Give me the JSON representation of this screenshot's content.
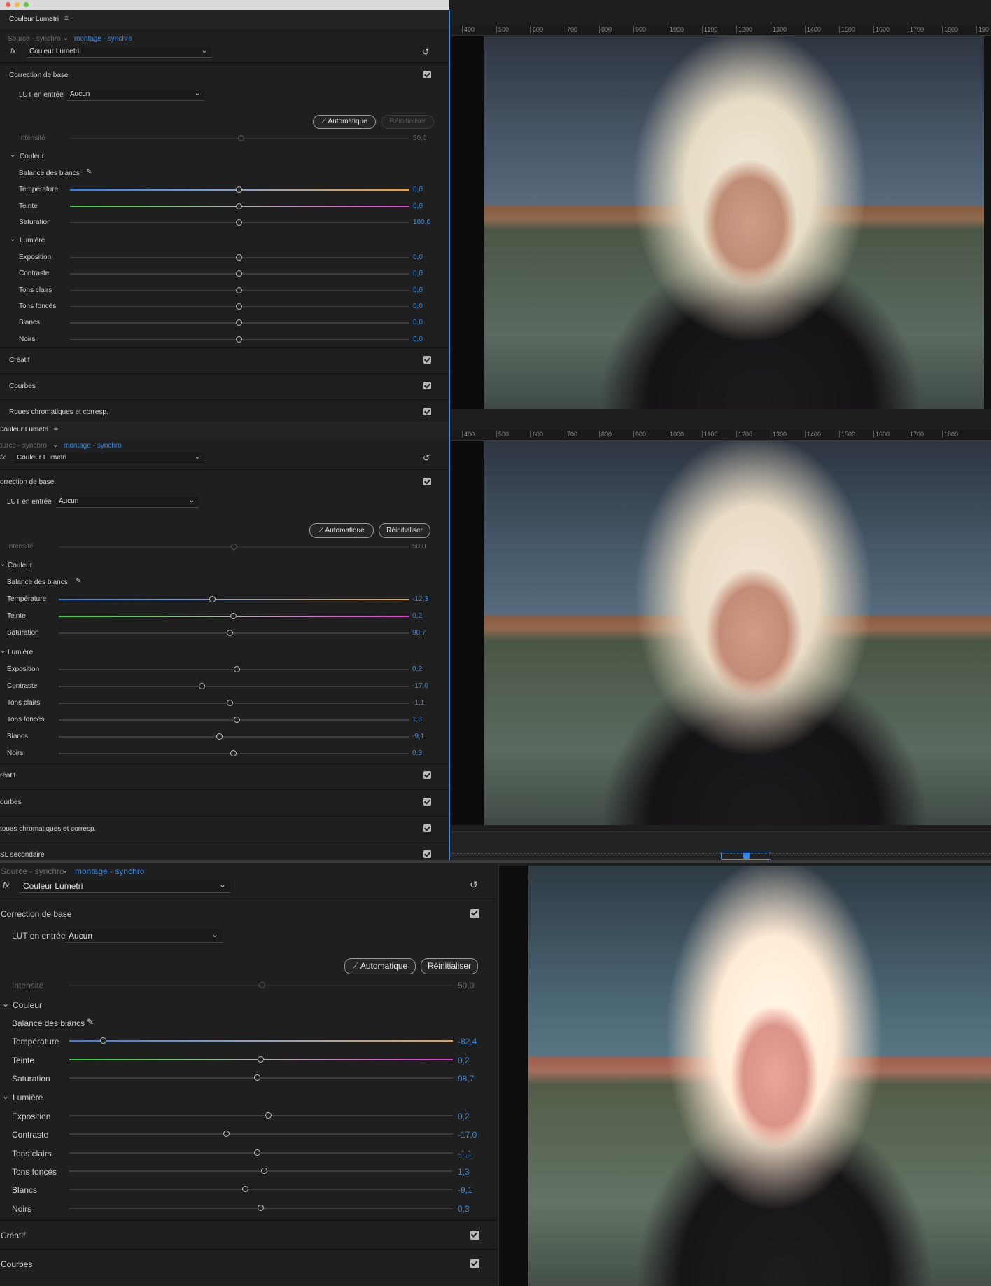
{
  "colors": {
    "accent": "#2d8ceb",
    "panel_bg": "#1f1f1f",
    "temp_left": "#2f7ff0",
    "temp_right": "#f0a030",
    "tint_left": "#39d13a",
    "tint_right": "#e23ed6"
  },
  "shots": [
    {
      "panel_title": "Couleur Lumetri",
      "source": "Source - synchro",
      "sequence": "montage - synchro",
      "effect": "Couleur Lumetri",
      "section_basic": "Correction de base",
      "lut_label": "LUT en entrée",
      "lut_value": "Aucun",
      "auto_button": "Automatique",
      "reset_button": "Réinitialiser",
      "reset_enabled": false,
      "intensity": {
        "label": "Intensité",
        "value": "50,0",
        "pos": 0.5
      },
      "color_header": "Couleur",
      "wb_label": "Balance des blancs",
      "color_sliders": [
        {
          "label": "Température",
          "value": "0,0",
          "pos": 0.5,
          "kind": "temp"
        },
        {
          "label": "Teinte",
          "value": "0,0",
          "pos": 0.5,
          "kind": "tint"
        },
        {
          "label": "Saturation",
          "value": "100,0",
          "pos": 0.5,
          "kind": "plain"
        }
      ],
      "light_header": "Lumière",
      "light_sliders": [
        {
          "label": "Exposition",
          "value": "0,0",
          "pos": 0.5
        },
        {
          "label": "Contraste",
          "value": "0,0",
          "pos": 0.5
        },
        {
          "label": "Tons clairs",
          "value": "0,0",
          "pos": 0.5
        },
        {
          "label": "Tons foncés",
          "value": "0,0",
          "pos": 0.5
        },
        {
          "label": "Blancs",
          "value": "0,0",
          "pos": 0.5
        },
        {
          "label": "Noirs",
          "value": "0,0",
          "pos": 0.5
        }
      ],
      "sections": [
        "Créatif",
        "Courbes",
        "Roues chromatiques et corresp."
      ],
      "ruler": [
        "400",
        "500",
        "600",
        "700",
        "800",
        "900",
        "1000",
        "1100",
        "1200",
        "1300",
        "1400",
        "1500",
        "1600",
        "1700",
        "1800",
        "190"
      ]
    },
    {
      "panel_title": "Couleur Lumetri",
      "source": "ource - synchro",
      "sequence": "montage - synchro",
      "effect": "Couleur Lumetri",
      "section_basic": "orrection de base",
      "lut_label": "LUT en entrée",
      "lut_value": "Aucun",
      "auto_button": "Automatique",
      "reset_button": "Réinitialiser",
      "reset_enabled": true,
      "intensity": {
        "label": "Intensité",
        "value": "50,0",
        "pos": 0.5
      },
      "color_header": "Couleur",
      "wb_label": "Balance des blancs",
      "color_sliders": [
        {
          "label": "Température",
          "value": "-12,3",
          "pos": 0.44,
          "kind": "temp"
        },
        {
          "label": "Teinte",
          "value": "0,2",
          "pos": 0.5,
          "kind": "tint"
        },
        {
          "label": "Saturation",
          "value": "98,7",
          "pos": 0.49,
          "kind": "plain"
        }
      ],
      "light_header": "Lumière",
      "light_sliders": [
        {
          "label": "Exposition",
          "value": "0,2",
          "pos": 0.51
        },
        {
          "label": "Contraste",
          "value": "-17,0",
          "pos": 0.41
        },
        {
          "label": "Tons clairs",
          "value": "-1,1",
          "pos": 0.49
        },
        {
          "label": "Tons foncés",
          "value": "1,3",
          "pos": 0.51
        },
        {
          "label": "Blancs",
          "value": "-9,1",
          "pos": 0.46
        },
        {
          "label": "Noirs",
          "value": "0,3",
          "pos": 0.5
        }
      ],
      "sections": [
        "réatif",
        "ourbes",
        "toues chromatiques et corresp.",
        "SL secondaire"
      ],
      "ruler": [
        "400",
        "500",
        "600",
        "700",
        "800",
        "900",
        "1000",
        "1100",
        "1200",
        "1300",
        "1400",
        "1500",
        "1600",
        "1700",
        "1800"
      ]
    },
    {
      "source": "Source - synchro",
      "sequence": "montage - synchro",
      "effect": "Couleur Lumetri",
      "section_basic": "Correction de base",
      "lut_label": "LUT en entrée",
      "lut_value": "Aucun",
      "auto_button": "Automatique",
      "reset_button": "Réinitialiser",
      "reset_enabled": true,
      "intensity": {
        "label": "Intensité",
        "value": "50,0",
        "pos": 0.5
      },
      "color_header": "Couleur",
      "wb_label": "Balance des blancs",
      "color_sliders": [
        {
          "label": "Température",
          "value": "-82,4",
          "pos": 0.09,
          "kind": "temp"
        },
        {
          "label": "Teinte",
          "value": "0,2",
          "pos": 0.5,
          "kind": "tint"
        },
        {
          "label": "Saturation",
          "value": "98,7",
          "pos": 0.49,
          "kind": "plain"
        }
      ],
      "light_header": "Lumière",
      "light_sliders": [
        {
          "label": "Exposition",
          "value": "0,2",
          "pos": 0.52
        },
        {
          "label": "Contraste",
          "value": "-17,0",
          "pos": 0.41
        },
        {
          "label": "Tons clairs",
          "value": "-1,1",
          "pos": 0.49
        },
        {
          "label": "Tons foncés",
          "value": "1,3",
          "pos": 0.51
        },
        {
          "label": "Blancs",
          "value": "-9,1",
          "pos": 0.46
        },
        {
          "label": "Noirs",
          "value": "0,3",
          "pos": 0.5
        }
      ],
      "sections": [
        "Créatif",
        "Courbes"
      ]
    }
  ]
}
